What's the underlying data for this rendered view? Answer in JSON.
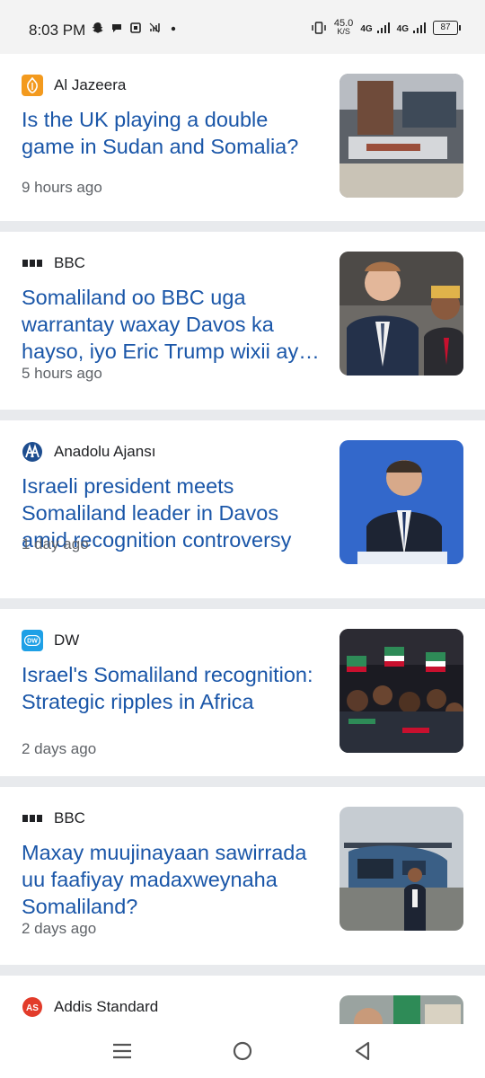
{
  "status_bar": {
    "time": "8:03 PM",
    "net_speed_value": "45.0",
    "net_speed_unit": "K/S",
    "sim1": "4G",
    "sim2": "4G",
    "battery": "87"
  },
  "articles": [
    {
      "source": "Al Jazeera",
      "logo_icon": "al-jazeera-logo",
      "logo_color": "#f39a1e",
      "headline": "Is the UK playing a double game in Sudan and Somalia?",
      "time": "9 hours ago",
      "thumb": "port-harbor-photo"
    },
    {
      "source": "BBC",
      "logo_icon": "bbc-logo",
      "logo_color": "#202124",
      "headline": "Somaliland oo BBC uga warrantay waxay Davos ka hayso, iyo Eric Trump wixii ay…",
      "time": "5 hours ago",
      "thumb": "two-men-photo"
    },
    {
      "source": "Anadolu Ajansı",
      "logo_icon": "anadolu-logo",
      "logo_color": "#1d4d8f",
      "headline": "Israeli president meets Somaliland leader in Davos amid recognition controversy",
      "time": "1 day ago",
      "thumb": "speaker-davos-photo"
    },
    {
      "source": "DW",
      "logo_icon": "dw-logo",
      "logo_color": "#1ea0e6",
      "headline": "Israel's Somaliland recognition: Strategic ripples in Africa",
      "time": "2 days ago",
      "thumb": "crowd-flags-photo"
    },
    {
      "source": "BBC",
      "logo_icon": "bbc-logo",
      "logo_color": "#202124",
      "headline": "Maxay muujinayaan sawirrada uu faafiyay madaxweynaha Somaliland?",
      "time": "2 days ago",
      "thumb": "helicopter-photo"
    },
    {
      "source": "Addis Standard",
      "logo_icon": "addis-standard-logo",
      "logo_color": "#e23b2a",
      "thumb": "partial-photo"
    }
  ],
  "navbar": {
    "menu": "menu-icon",
    "home": "home-icon",
    "back": "back-icon"
  }
}
